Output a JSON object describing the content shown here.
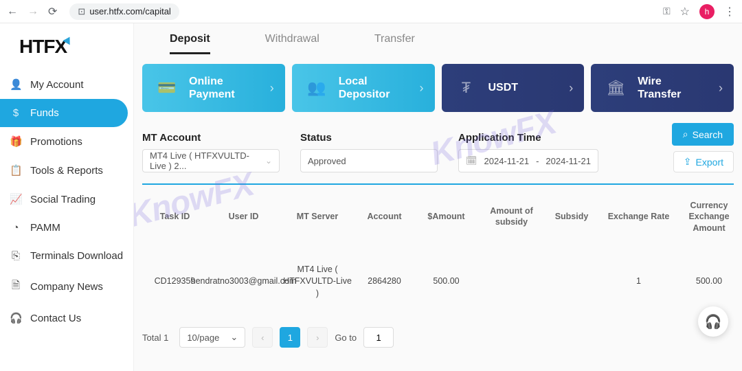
{
  "browser": {
    "url": "user.htfx.com/capital",
    "avatar_initial": "h"
  },
  "logo": {
    "text_a": "HTF",
    "text_b": "X"
  },
  "sidebar": {
    "items": [
      {
        "icon": "👤",
        "label": "My Account"
      },
      {
        "icon": "$",
        "label": "Funds"
      },
      {
        "icon": "🎁",
        "label": "Promotions"
      },
      {
        "icon": "📋",
        "label": "Tools & Reports"
      },
      {
        "icon": "📈",
        "label": "Social Trading"
      },
      {
        "icon": "◔",
        "label": "PAMM"
      },
      {
        "icon": "⎘",
        "label": "Terminals Download"
      },
      {
        "icon": "🗎",
        "label": "Company News"
      },
      {
        "icon": "🎧",
        "label": "Contact Us"
      }
    ]
  },
  "tabs": {
    "deposit": "Deposit",
    "withdrawal": "Withdrawal",
    "transfer": "Transfer"
  },
  "cards": {
    "online": {
      "line1": "Online",
      "line2": "Payment"
    },
    "local": {
      "line1": "Local",
      "line2": "Depositor"
    },
    "usdt": {
      "label": "USDT"
    },
    "wire": {
      "line1": "Wire",
      "line2": "Transfer"
    }
  },
  "filters": {
    "mt_label": "MT Account",
    "mt_value": "MT4 Live ( HTFXVULTD-Live ) 2...",
    "status_label": "Status",
    "status_value": "Approved",
    "apptime_label": "Application Time",
    "date_from": "2024-11-21",
    "date_sep": "-",
    "date_to": "2024-11-21",
    "search_label": "Search",
    "export_label": "Export"
  },
  "table": {
    "headers": {
      "task_id": "Task ID",
      "user_id": "User ID",
      "mt_server": "MT Server",
      "account": "Account",
      "amount": "$Amount",
      "subsidy_amount": "Amount of subsidy",
      "subsidy": "Subsidy",
      "exchange_rate": "Exchange Rate",
      "currency_exchange_amount": "Currency Exchange Amount"
    },
    "rows": [
      {
        "task_id": "CD129359",
        "user_id": "hendratno3003@gmail.com",
        "mt_server": "MT4 Live ( HTFXVULTD-Live )",
        "account": "2864280",
        "amount": "500.00",
        "subsidy_amount": "",
        "subsidy": "",
        "exchange_rate": "1",
        "currency_exchange_amount": "500.00"
      }
    ]
  },
  "pager": {
    "total_label": "Total 1",
    "per_page": "10/page",
    "current": "1",
    "goto_label": "Go to",
    "goto_value": "1"
  },
  "watermark": "KnowFX"
}
